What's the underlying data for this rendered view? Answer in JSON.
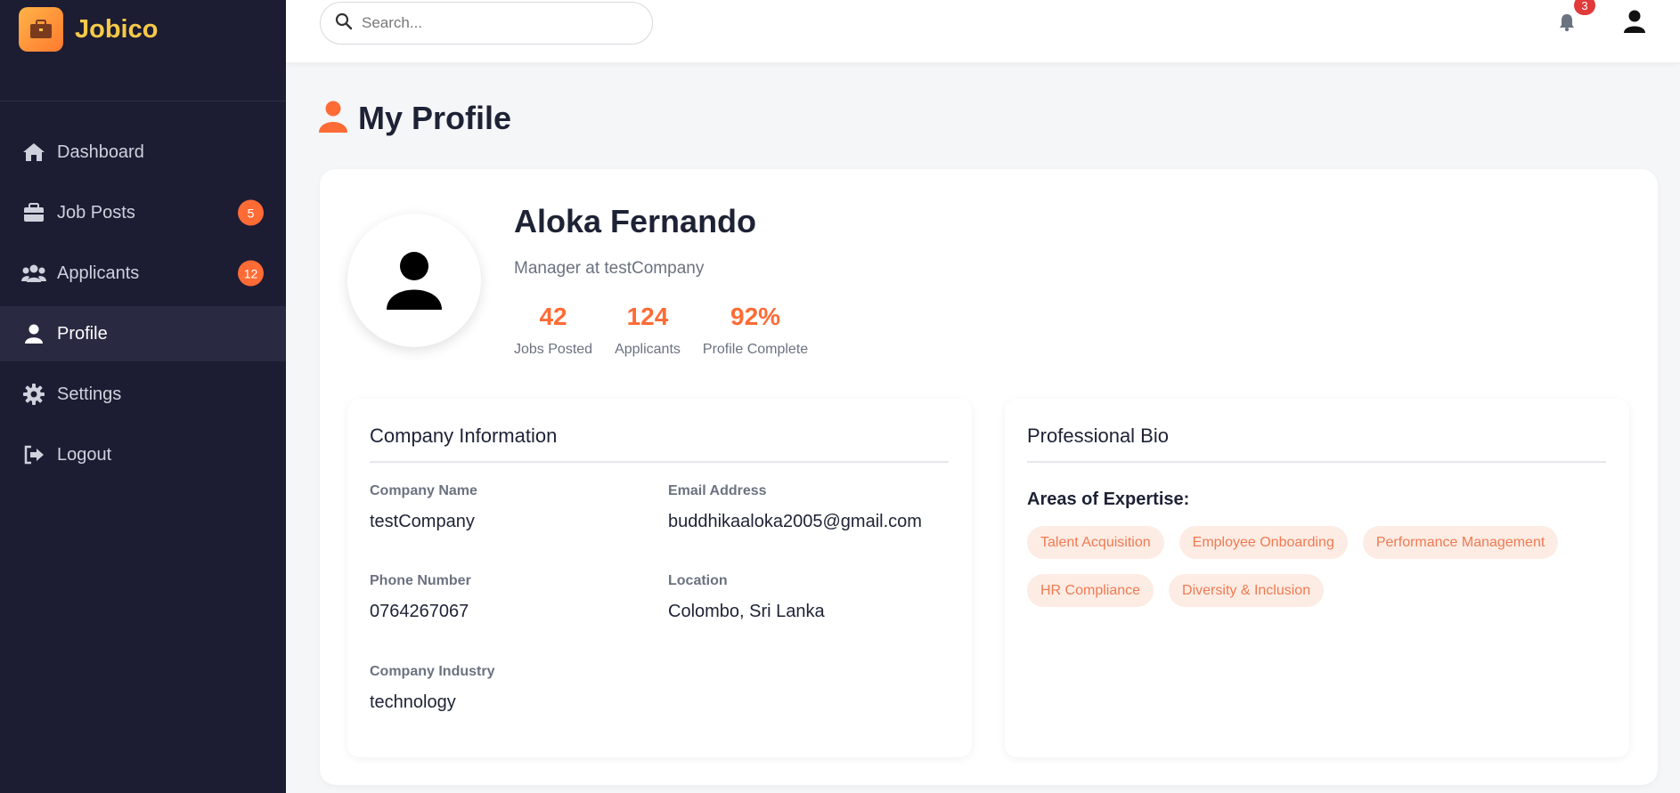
{
  "brand": {
    "name": "Jobico",
    "logo_icon": "briefcase-icon",
    "accent": "#f7c948"
  },
  "sidebar": {
    "items": [
      {
        "label": "Dashboard",
        "icon": "home-icon",
        "badge": ""
      },
      {
        "label": "Job Posts",
        "icon": "briefcase-icon",
        "badge": "5"
      },
      {
        "label": "Applicants",
        "icon": "users-icon",
        "badge": "12"
      },
      {
        "label": "Profile",
        "icon": "user-icon",
        "badge": "",
        "active": true
      },
      {
        "label": "Settings",
        "icon": "gear-icon",
        "badge": ""
      },
      {
        "label": "Logout",
        "icon": "logout-icon",
        "badge": ""
      }
    ]
  },
  "topbar": {
    "search_placeholder": "Search...",
    "notification_count": "3"
  },
  "page": {
    "title": "My Profile"
  },
  "profile": {
    "name": "Aloka Fernando",
    "role": "Manager at testCompany",
    "stats": [
      {
        "value": "42",
        "label": "Jobs Posted"
      },
      {
        "value": "124",
        "label": "Applicants"
      },
      {
        "value": "92%",
        "label": "Profile Complete"
      }
    ]
  },
  "company_info": {
    "title": "Company Information",
    "fields": [
      {
        "label": "Company Name",
        "value": "testCompany"
      },
      {
        "label": "Email Address",
        "value": "buddhikaaloka2005@gmail.com"
      },
      {
        "label": "Phone Number",
        "value": "0764267067"
      },
      {
        "label": "Location",
        "value": "Colombo, Sri Lanka"
      },
      {
        "label": "Company Industry",
        "value": "technology"
      }
    ]
  },
  "bio": {
    "title": "Professional Bio",
    "expertise_title": "Areas of Expertise:",
    "tags": [
      "Talent Acquisition",
      "Employee Onboarding",
      "Performance Management",
      "HR Compliance",
      "Diversity & Inclusion"
    ]
  },
  "colors": {
    "sidebar_bg": "#1c1c33",
    "accent": "#ff6b35",
    "notification": "#e03a3a"
  }
}
